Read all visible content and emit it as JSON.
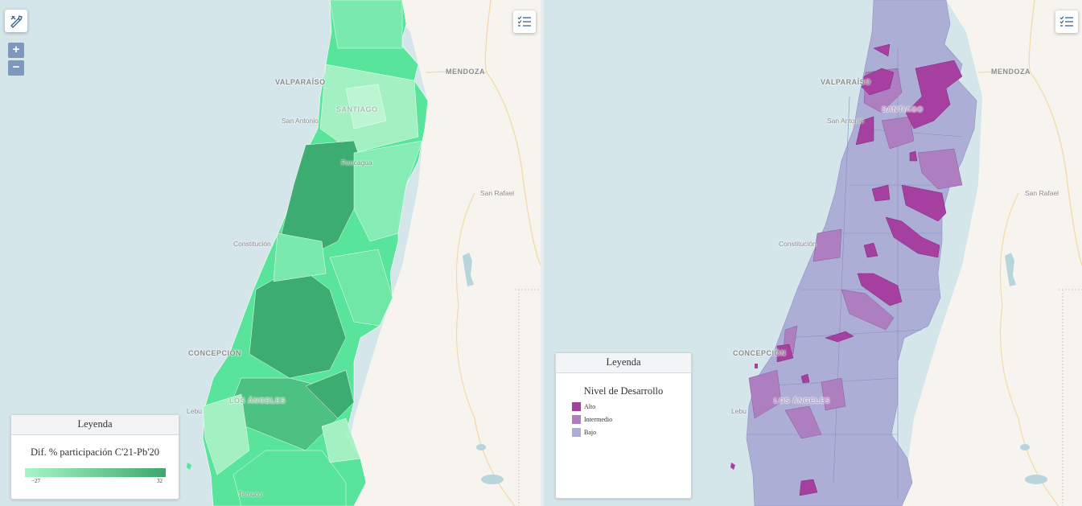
{
  "map_left": {
    "cities": [
      {
        "id": "valparaiso",
        "label": "VALPARAÍSO"
      },
      {
        "id": "mendoza",
        "label": "MENDOZA"
      },
      {
        "id": "santiago",
        "label": "SANTIAGO"
      },
      {
        "id": "san-antonio",
        "label": "San Antonio"
      },
      {
        "id": "rancagua",
        "label": "Rancagua"
      },
      {
        "id": "san-rafael",
        "label": "San Rafael"
      },
      {
        "id": "constitucion",
        "label": "Constitución"
      },
      {
        "id": "concepcion",
        "label": "CONCEPCIÓN"
      },
      {
        "id": "los-angeles",
        "label": "LOS ÁNGELES"
      },
      {
        "id": "lebu",
        "label": "Lebu"
      },
      {
        "id": "temuco",
        "label": "Temuco"
      }
    ],
    "zoom_in_label": "+",
    "zoom_out_label": "−",
    "legend": {
      "title": "Leyenda",
      "subtitle": "Dif. % participación C'21-Pb'20",
      "min_label": "−27",
      "max_label": "32",
      "gradient_from": "#a6f5c8",
      "gradient_to": "#3fa66e"
    },
    "colors": {
      "low": "#a8f2c6",
      "mid": "#58e49a",
      "high": "#3caa6f"
    }
  },
  "map_right": {
    "cities": [
      {
        "id": "valparaiso",
        "label": "VALPARAÍSO"
      },
      {
        "id": "mendoza",
        "label": "MENDOZA"
      },
      {
        "id": "santiago",
        "label": "SANTIAGO"
      },
      {
        "id": "san-antonio",
        "label": "San Antonio"
      },
      {
        "id": "san-rafael",
        "label": "San Rafael"
      },
      {
        "id": "constitucion",
        "label": "Constitución"
      },
      {
        "id": "concepcion",
        "label": "CONCEPCIÓN"
      },
      {
        "id": "los-angeles",
        "label": "LOS ÁNGELES"
      },
      {
        "id": "lebu",
        "label": "Lebu"
      }
    ],
    "legend": {
      "title": "Leyenda",
      "subtitle": "Nivel de Desarrollo",
      "items": [
        {
          "label": "Alto",
          "color": "#a53fa0"
        },
        {
          "label": "Intermedio",
          "color": "#ad7fc0"
        },
        {
          "label": "Bajo",
          "color": "#acaed6"
        }
      ]
    }
  },
  "icons": {
    "draw_tool": "draw-tool-icon",
    "layers": "layer-list-icon"
  }
}
